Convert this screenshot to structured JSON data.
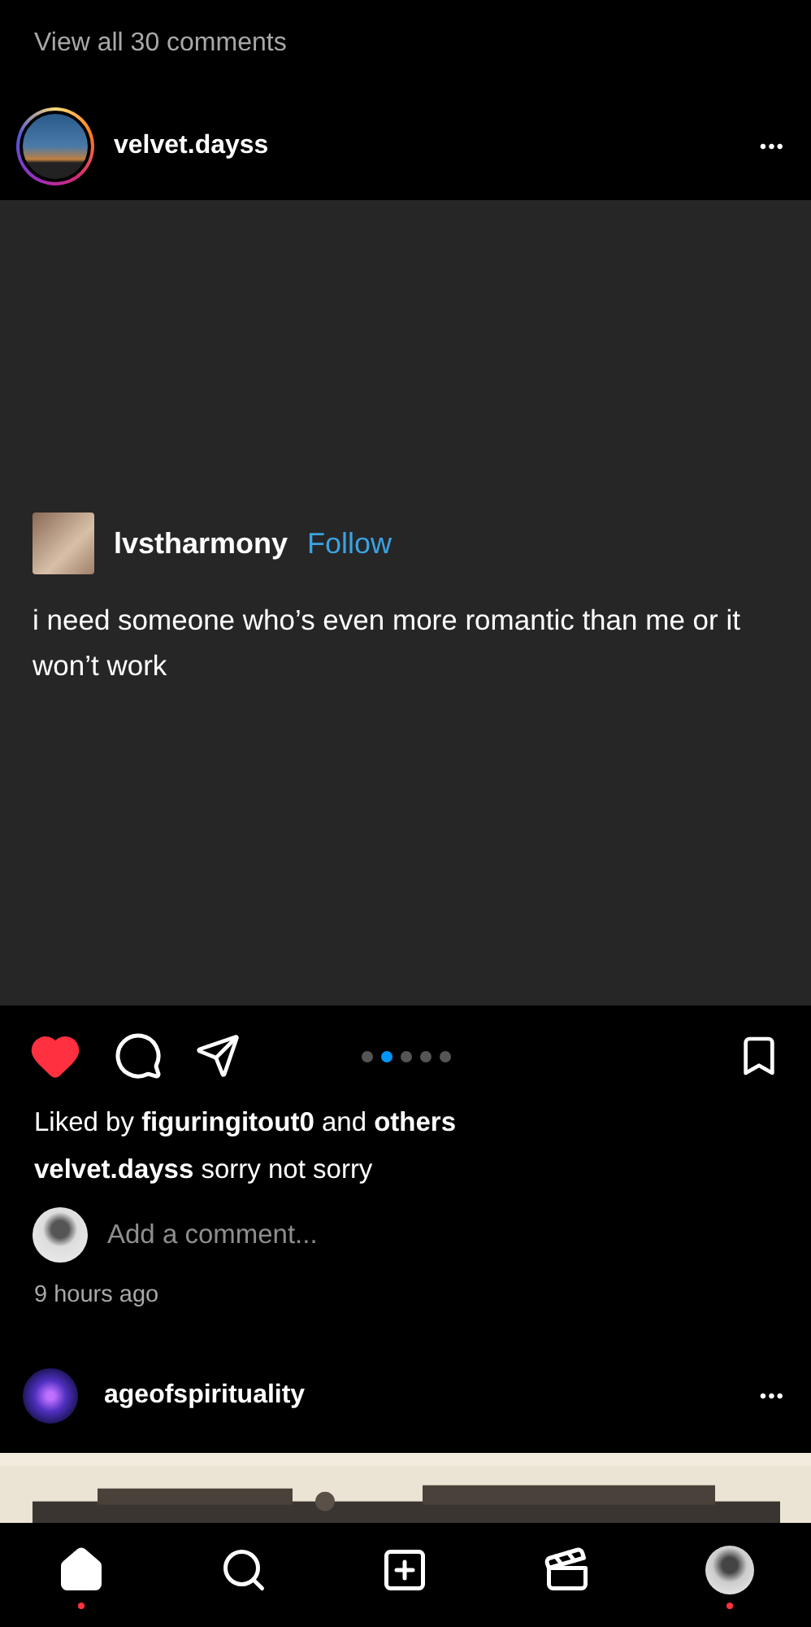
{
  "top_link": "View all 30 comments",
  "post": {
    "username": "velvet.dayss",
    "more": "•••",
    "embedded": {
      "username": "lvstharmony",
      "follow": "Follow",
      "text": "i need someone who’s even more romantic than me or it won’t work"
    },
    "liked": true,
    "carousel": [
      {
        "selected": false
      },
      {
        "selected": true
      },
      {
        "selected": false
      },
      {
        "selected": false
      },
      {
        "selected": false
      }
    ],
    "saved": false,
    "likes": {
      "prefix": "Liked by",
      "user": "figuringitout0",
      "middle": "and",
      "suffix": "others"
    },
    "caption": {
      "user": "velvet.dayss",
      "text": "sorry not sorry"
    },
    "comment_placeholder": "Add a comment...",
    "time": "9 hours ago"
  },
  "next_post": {
    "username": "ageofspirituality",
    "more": "•••"
  },
  "nav": [
    {
      "kind": "home",
      "selected": true,
      "dot": true
    },
    {
      "kind": "search",
      "selected": false,
      "dot": false
    },
    {
      "kind": "add",
      "selected": false,
      "dot": false
    },
    {
      "kind": "reels",
      "selected": false,
      "dot": false
    },
    {
      "kind": "profile",
      "selected": false,
      "dot": true
    }
  ]
}
